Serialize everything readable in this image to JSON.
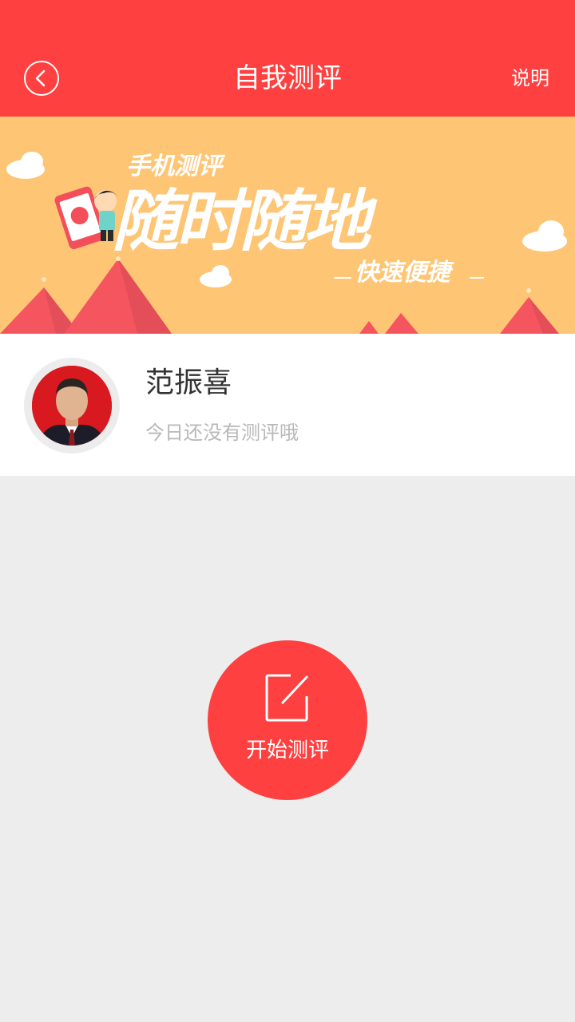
{
  "header": {
    "title": "自我测评",
    "right_action": "说明",
    "back_icon": "chevron-left-icon",
    "bg_color": "#ff4040"
  },
  "banner": {
    "line1": "手机测评",
    "line2": "随时随地",
    "line3": "快速便捷",
    "bg_color": "#fdc574"
  },
  "profile": {
    "name": "范振喜",
    "status": "今日还没有测评哦"
  },
  "action": {
    "label": "开始测评",
    "icon": "edit-icon"
  }
}
